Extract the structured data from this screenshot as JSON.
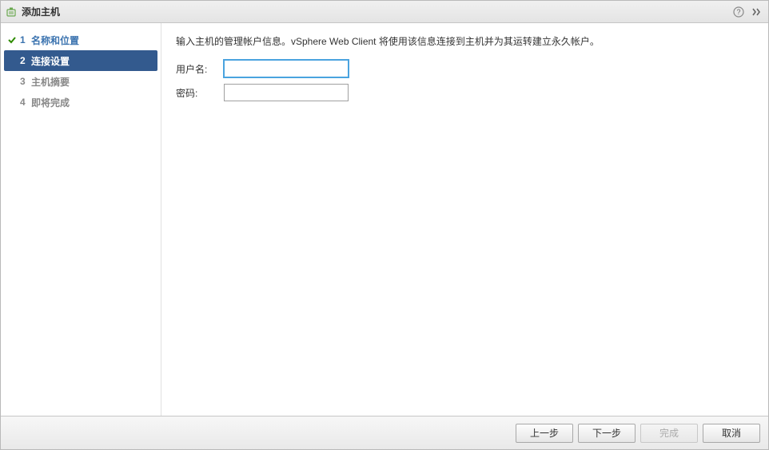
{
  "title": "添加主机",
  "steps": [
    {
      "num": "1",
      "label": "名称和位置",
      "state": "completed"
    },
    {
      "num": "2",
      "label": "连接设置",
      "state": "current"
    },
    {
      "num": "3",
      "label": "主机摘要",
      "state": "pending"
    },
    {
      "num": "4",
      "label": "即将完成",
      "state": "pending"
    }
  ],
  "instruction": "输入主机的管理帐户信息。vSphere Web Client 将使用该信息连接到主机并为其运转建立永久帐户。",
  "form": {
    "username_label": "用户名:",
    "username_value": "",
    "username_placeholder": "",
    "password_label": "密码:",
    "password_value": "",
    "password_placeholder": ""
  },
  "buttons": {
    "back": "上一步",
    "next": "下一步",
    "finish": "完成",
    "cancel": "取消"
  }
}
